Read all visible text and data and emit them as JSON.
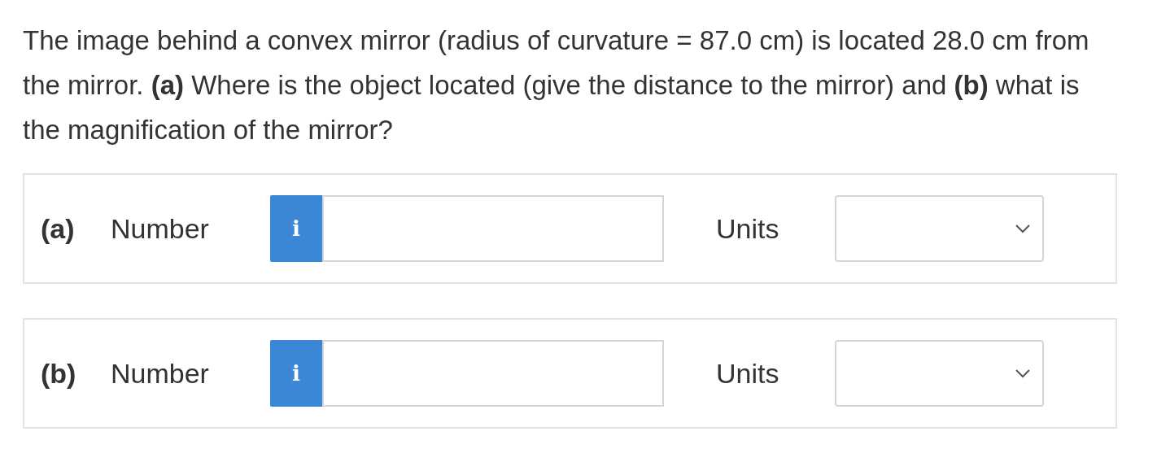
{
  "question": "The image behind a convex mirror (radius of curvature = 87.0 cm) is located 28.0 cm from the mirror. **(a)** Where is the object located (give the distance to the mirror) and **(b)** what is the magnification of the mirror?",
  "parts": [
    {
      "label": "(a)",
      "field_label": "Number",
      "info": "i",
      "units_label": "Units"
    },
    {
      "label": "(b)",
      "field_label": "Number",
      "info": "i",
      "units_label": "Units"
    }
  ]
}
